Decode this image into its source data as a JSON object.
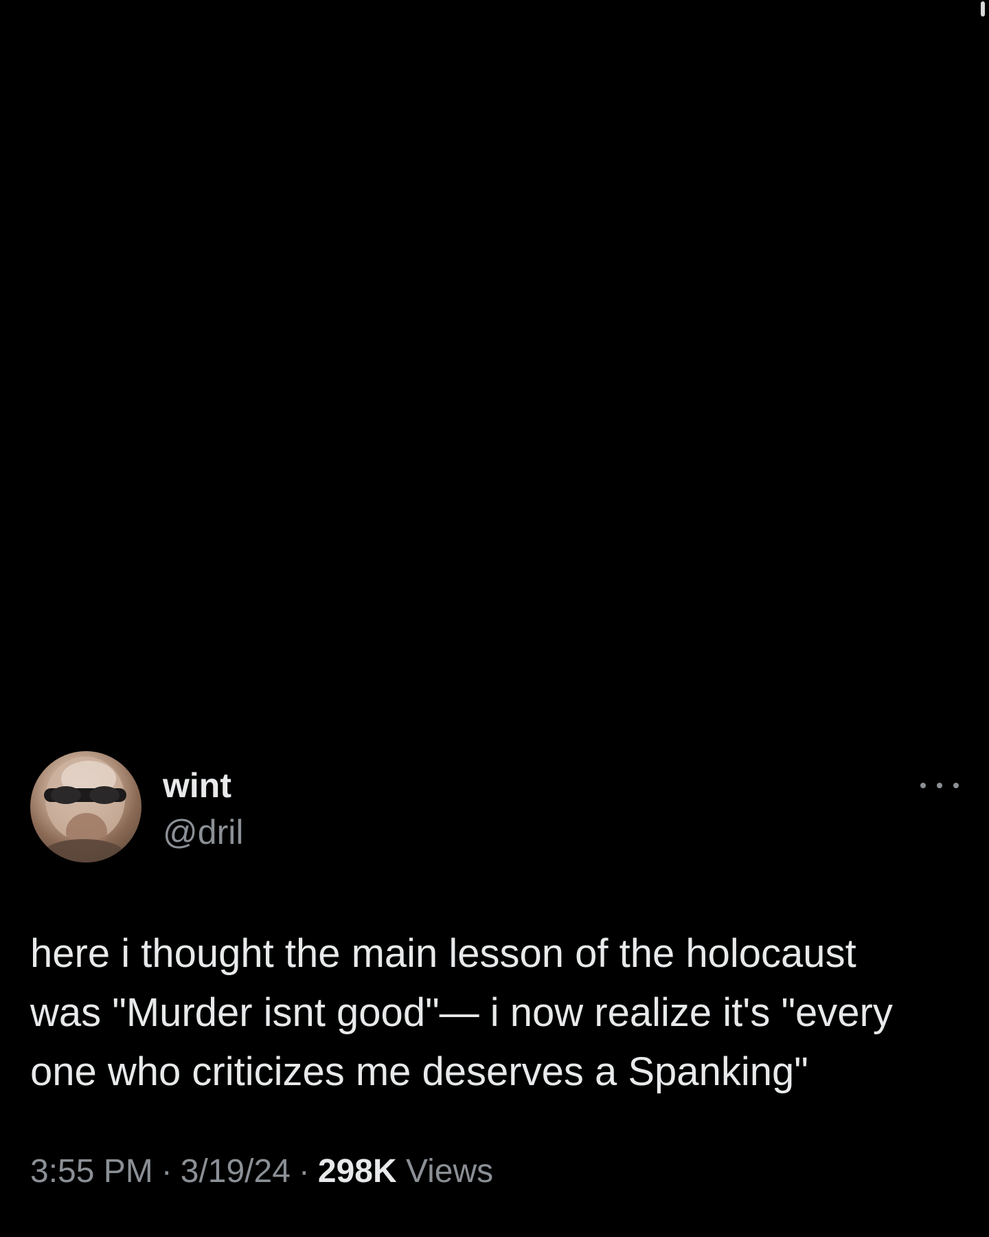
{
  "author": {
    "display_name": "wint",
    "handle": "@dril",
    "avatar": "user-avatar-photo"
  },
  "more_icon": "more-dots-icon",
  "tweet": {
    "text": "here i thought the main lesson of the holocaust\nwas \"Murder isnt good\"— i now realize it's \"every\none who criticizes me deserves a Spanking\""
  },
  "meta": {
    "time": "3:55 PM",
    "separator": "·",
    "date": "3/19/24",
    "views_count": "298K",
    "views_label": "Views"
  },
  "colors": {
    "background": "#000000",
    "primary_text": "#e7e9ea",
    "secondary_text": "#8b9096"
  }
}
